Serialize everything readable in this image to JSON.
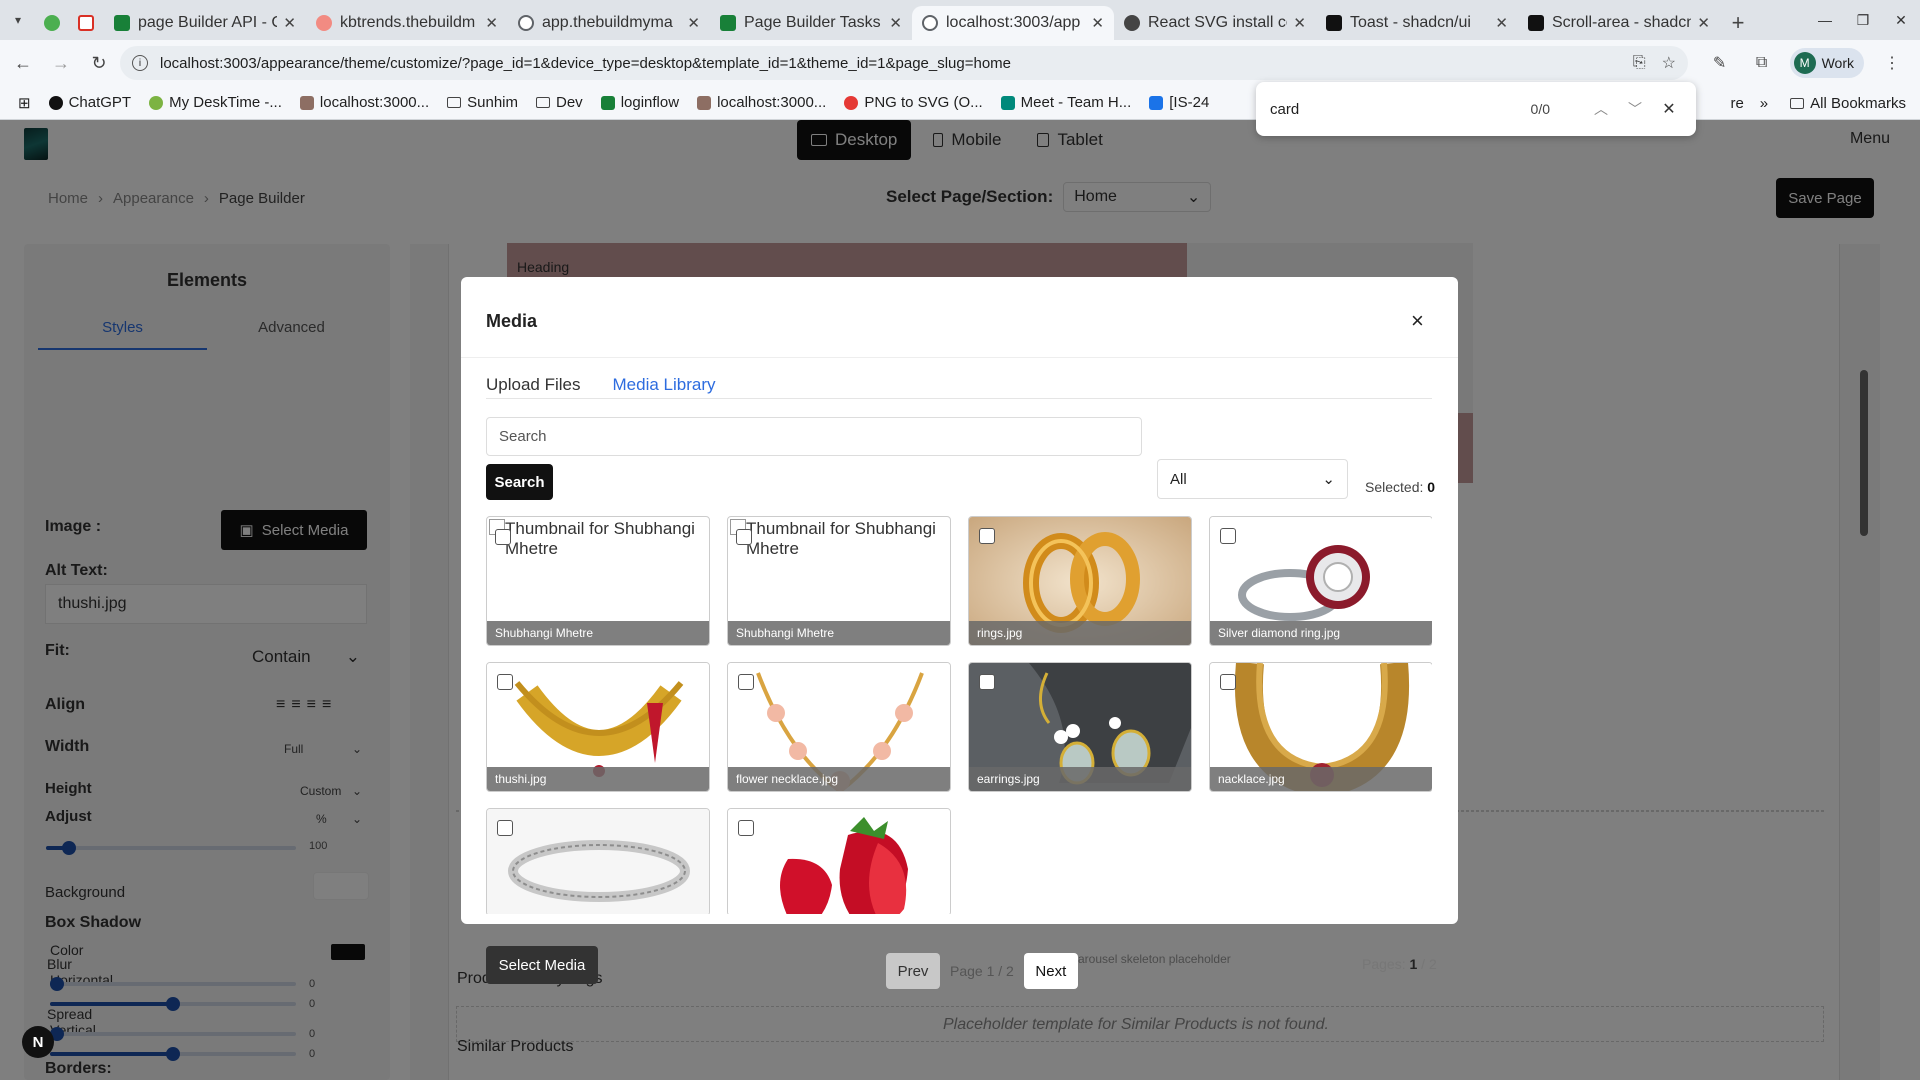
{
  "browser": {
    "tabs": [
      {
        "title": "",
        "color": "#4caf50"
      },
      {
        "title": "",
        "color": "#d93025"
      },
      {
        "title": "page Builder API - C",
        "color": "#188038"
      },
      {
        "title": "kbtrends.thebuildm",
        "color": "#f28b82"
      },
      {
        "title": "app.thebuildmyma",
        "color": "#5f6368"
      },
      {
        "title": "Page Builder Tasks",
        "color": "#188038"
      },
      {
        "title": "localhost:3003/app",
        "color": "#5f6368",
        "active": true
      },
      {
        "title": "React SVG install cc",
        "color": "#444444"
      },
      {
        "title": "Toast - shadcn/ui",
        "color": "#111111"
      },
      {
        "title": "Scroll-area - shadcn",
        "color": "#111111"
      }
    ],
    "url": "localhost:3003/appearance/theme/customize/?page_id=1&device_type=desktop&template_id=1&theme_id=1&page_slug=home",
    "profile": {
      "initial": "M",
      "label": "Work"
    },
    "bookmarks": [
      {
        "label": "ChatGPT",
        "color": "#111111",
        "type": "site"
      },
      {
        "label": "My DeskTime -...",
        "color": "#7cb342",
        "type": "site"
      },
      {
        "label": "localhost:3000...",
        "color": "#8d6e63",
        "type": "site"
      },
      {
        "label": "Sunhim",
        "type": "folder"
      },
      {
        "label": "Dev",
        "type": "folder"
      },
      {
        "label": "loginflow",
        "color": "#188038",
        "type": "site"
      },
      {
        "label": "localhost:3000...",
        "color": "#8d6e63",
        "type": "site"
      },
      {
        "label": "PNG to SVG (O...",
        "color": "#e53935",
        "type": "site"
      },
      {
        "label": "Meet - Team H...",
        "color": "#00897b",
        "type": "site"
      },
      {
        "label": "[IS-24",
        "color": "#1a73e8",
        "type": "site"
      }
    ],
    "bookmarks_more": "»",
    "bookmarks_partial": "re",
    "all_bookmarks": "All Bookmarks",
    "find": {
      "query": "card",
      "count": "0/0"
    }
  },
  "app": {
    "device_switch": [
      {
        "label": "Desktop",
        "active": true
      },
      {
        "label": "Mobile",
        "active": false
      },
      {
        "label": "Tablet",
        "active": false
      }
    ],
    "menu_label": "Menu",
    "breadcrumb": [
      "Home",
      "Appearance",
      "Page Builder"
    ],
    "select_page_label": "Select Page/Section:",
    "select_page_value": "Home",
    "save_label": "Save Page",
    "sidebar": {
      "title": "Elements",
      "tabs": [
        "Styles",
        "Advanced"
      ],
      "image_label": "Image :",
      "select_media_label": "Select Media",
      "alt_text_label": "Alt Text:",
      "alt_text_value": "thushi.jpg",
      "fit_label": "Fit:",
      "fit_value": "Contain",
      "align_label": "Align",
      "width_label": "Width",
      "width_value": "Full",
      "height_label": "Height",
      "height_value": "Custom",
      "adjust_label": "Adjust",
      "adjust_unit": "%",
      "adjust_value": "100",
      "background_label": "Background",
      "box_shadow_label": "Box Shadow",
      "color_label": "Color",
      "horizontal_label": "Horizontal",
      "horizontal_value": "0",
      "vertical_label": "Vertical",
      "vertical_value": "0",
      "blur_label": "Blur",
      "blur_value": "0",
      "spread_label": "Spread",
      "spread_value": "0",
      "borders_label": "Borders:"
    },
    "canvas": {
      "heading": "Heading",
      "product_list_label": "Product List By Tags",
      "similar_products_label": "Similar Products",
      "placeholder_text": "Placeholder template for Similar Products is not found.",
      "carousel_text": "carousel skeleton placeholder"
    },
    "pager": {
      "prev": "Prev",
      "info": "Page 1 / 2",
      "next": "Next",
      "pages_label": "Pages:",
      "current_page": "1",
      "total_pages": "/ 2"
    },
    "under_select_media": "Select Media"
  },
  "modal": {
    "title": "Media",
    "tabs": [
      {
        "label": "Upload Files",
        "active": false
      },
      {
        "label": "Media Library",
        "active": true
      }
    ],
    "search_placeholder": "Search",
    "search_button": "Search",
    "filter_value": "All",
    "selected_label": "Selected:",
    "selected_count": "0",
    "items": [
      {
        "caption": "Shubhangi Mhetre",
        "alt": "Thumbnail for Shubhangi Mhetre",
        "kind": "broken"
      },
      {
        "caption": "Shubhangi Mhetre",
        "alt": "Thumbnail for Shubhangi Mhetre",
        "kind": "broken"
      },
      {
        "caption": "rings.jpg",
        "kind": "rings"
      },
      {
        "caption": "Silver diamond ring.jpg",
        "kind": "silver-ring"
      },
      {
        "caption": "thushi.jpg",
        "kind": "thushi"
      },
      {
        "caption": "flower necklace.jpg",
        "kind": "flower"
      },
      {
        "caption": "earrings.jpg",
        "kind": "earrings"
      },
      {
        "caption": "nacklace.jpg",
        "kind": "necklace"
      },
      {
        "caption": "",
        "kind": "bracelet"
      },
      {
        "caption": "",
        "kind": "strawberry"
      }
    ]
  }
}
